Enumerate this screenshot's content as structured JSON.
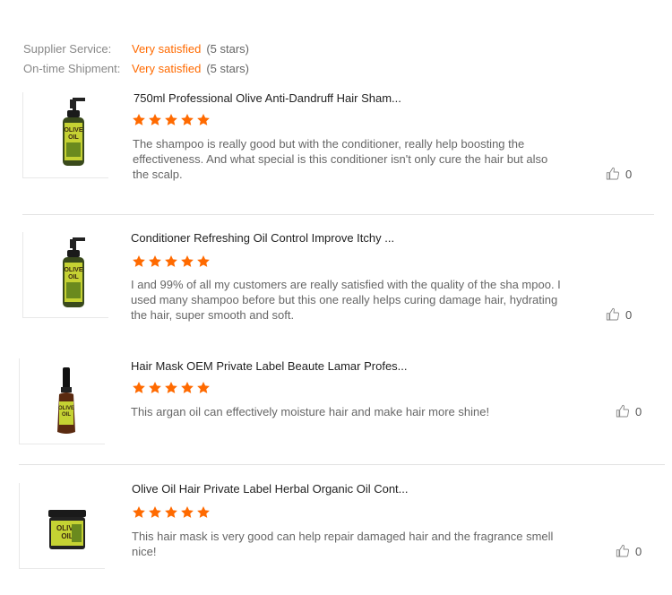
{
  "summary": {
    "supplier_service": {
      "label": "Supplier Service:",
      "value": "Very satisfied",
      "stars": "(5 stars)"
    },
    "ontime_shipment": {
      "label": "On-time Shipment:",
      "value": "Very satisfied",
      "stars": "(5 stars)"
    }
  },
  "colors": {
    "accent": "#ff6a00",
    "star": "#ff6a00",
    "text_muted": "#666666"
  },
  "reviews": [
    {
      "product_title": "750ml Professional Olive Anti-Dandruff Hair Sham...",
      "rating": 5,
      "text": "The shampoo is really good but with the conditioner, really help boosting the effectiveness. And what special is this conditioner isn't only cure the hair but also the scalp.",
      "likes": "0",
      "thumbnail": "olive-oil-pump-bottle"
    },
    {
      "product_title": "Conditioner Refreshing Oil Control Improve Itchy ...",
      "rating": 5,
      "text": "I and 99% of all my customers are really satisfied with the quality of the sha mpoo. I used many shampoo before but this one really helps curing damage hair, hydrating the hair, super smooth and soft.",
      "likes": "0",
      "thumbnail": "olive-oil-pump-bottle"
    },
    {
      "product_title": "Hair Mask OEM Private Label Beaute Lamar Profes...",
      "rating": 5,
      "text": "This argan oil can effectively moisture hair and make hair more shine!",
      "likes": "0",
      "thumbnail": "olive-oil-dropper-bottle"
    },
    {
      "product_title": "Olive Oil Hair Private Label Herbal Organic Oil Cont...",
      "rating": 5,
      "text": "This hair mask is very good can help repair damaged hair and the fragrance smell nice!",
      "likes": "0",
      "thumbnail": "olive-oil-jar"
    }
  ]
}
